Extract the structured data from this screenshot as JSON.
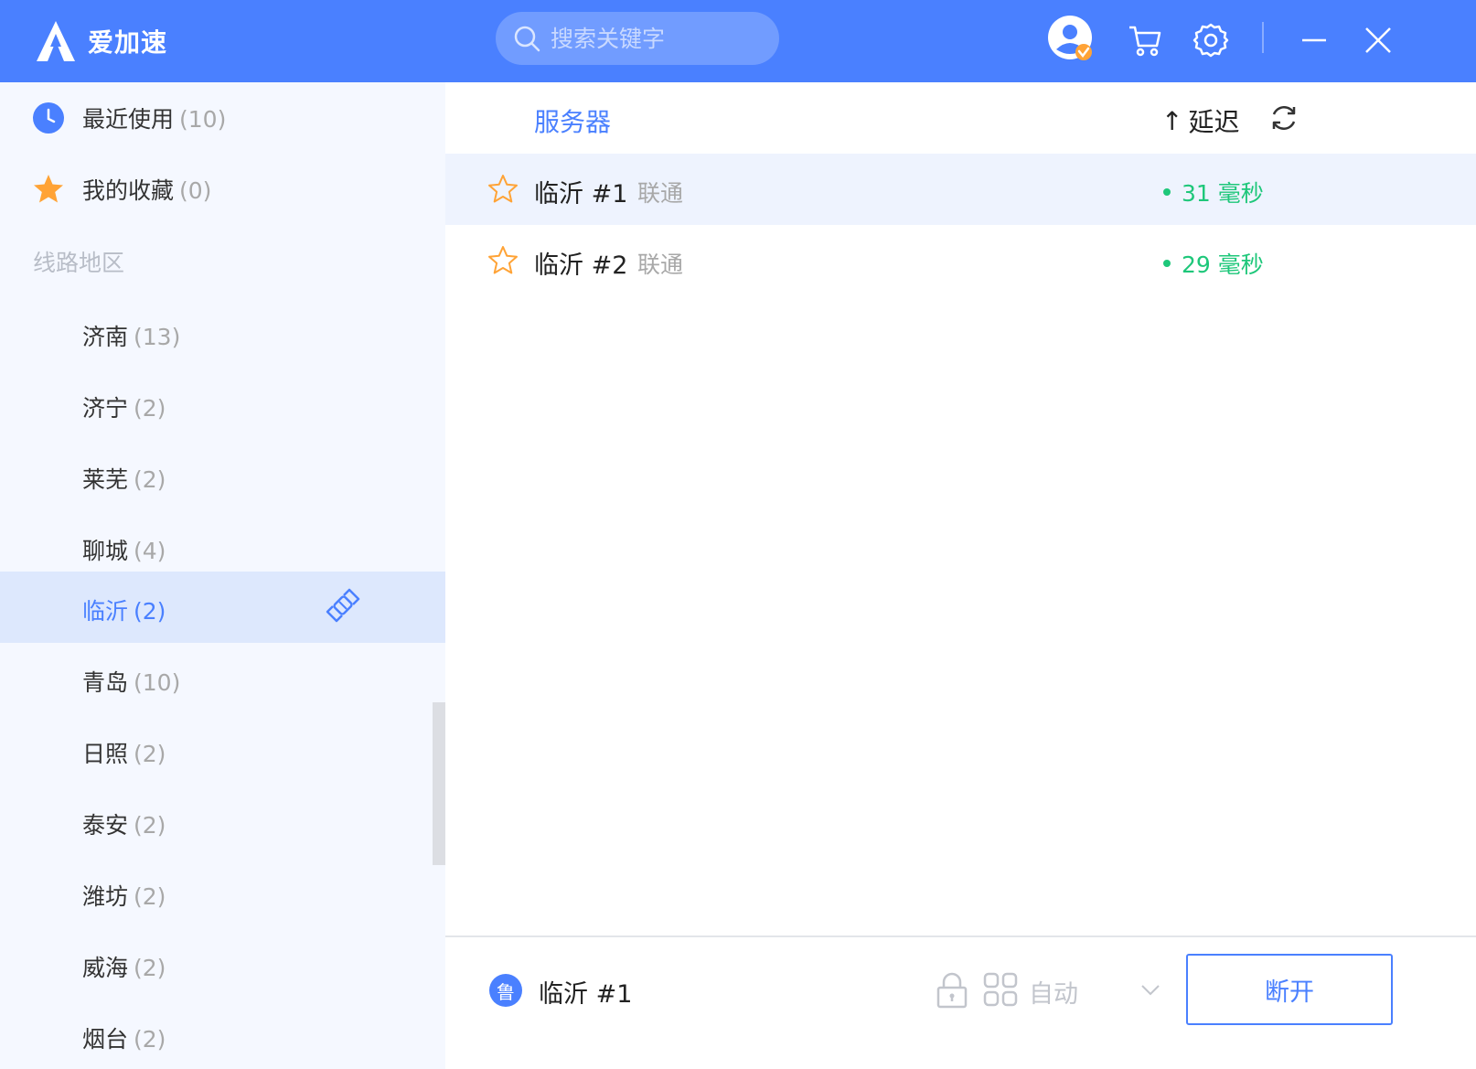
{
  "app": {
    "name": "爱加速"
  },
  "search": {
    "placeholder": "搜索关键字"
  },
  "sidebar": {
    "recent": {
      "label": "最近使用",
      "count": "(10)"
    },
    "favorites": {
      "label": "我的收藏",
      "count": "(0)"
    },
    "section_title": "线路地区",
    "regions": [
      {
        "name": "济南",
        "count": "(13)"
      },
      {
        "name": "济宁",
        "count": "(2)"
      },
      {
        "name": "莱芜",
        "count": "(2)"
      },
      {
        "name": "聊城",
        "count": "(4)"
      },
      {
        "name": "临沂",
        "count": "(2)"
      },
      {
        "name": "青岛",
        "count": "(10)"
      },
      {
        "name": "日照",
        "count": "(2)"
      },
      {
        "name": "泰安",
        "count": "(2)"
      },
      {
        "name": "潍坊",
        "count": "(2)"
      },
      {
        "name": "威海",
        "count": "(2)"
      },
      {
        "name": "烟台",
        "count": "(2)"
      }
    ],
    "active_region": "临沂"
  },
  "table": {
    "col_server": "服务器",
    "col_latency_arrow": "↑",
    "col_latency": "延迟",
    "rows": [
      {
        "name": "临沂 #1",
        "isp": "联通",
        "ping": "31 毫秒"
      },
      {
        "name": "临沂 #2",
        "isp": "联通",
        "ping": "29 毫秒"
      }
    ]
  },
  "footer": {
    "badge": "鲁",
    "current_server": "临沂 #1",
    "mode": "自动",
    "disconnect_label": "断开"
  },
  "colors": {
    "primary": "#4a80ff",
    "green": "#1ec77a",
    "orange": "#ffa336"
  }
}
